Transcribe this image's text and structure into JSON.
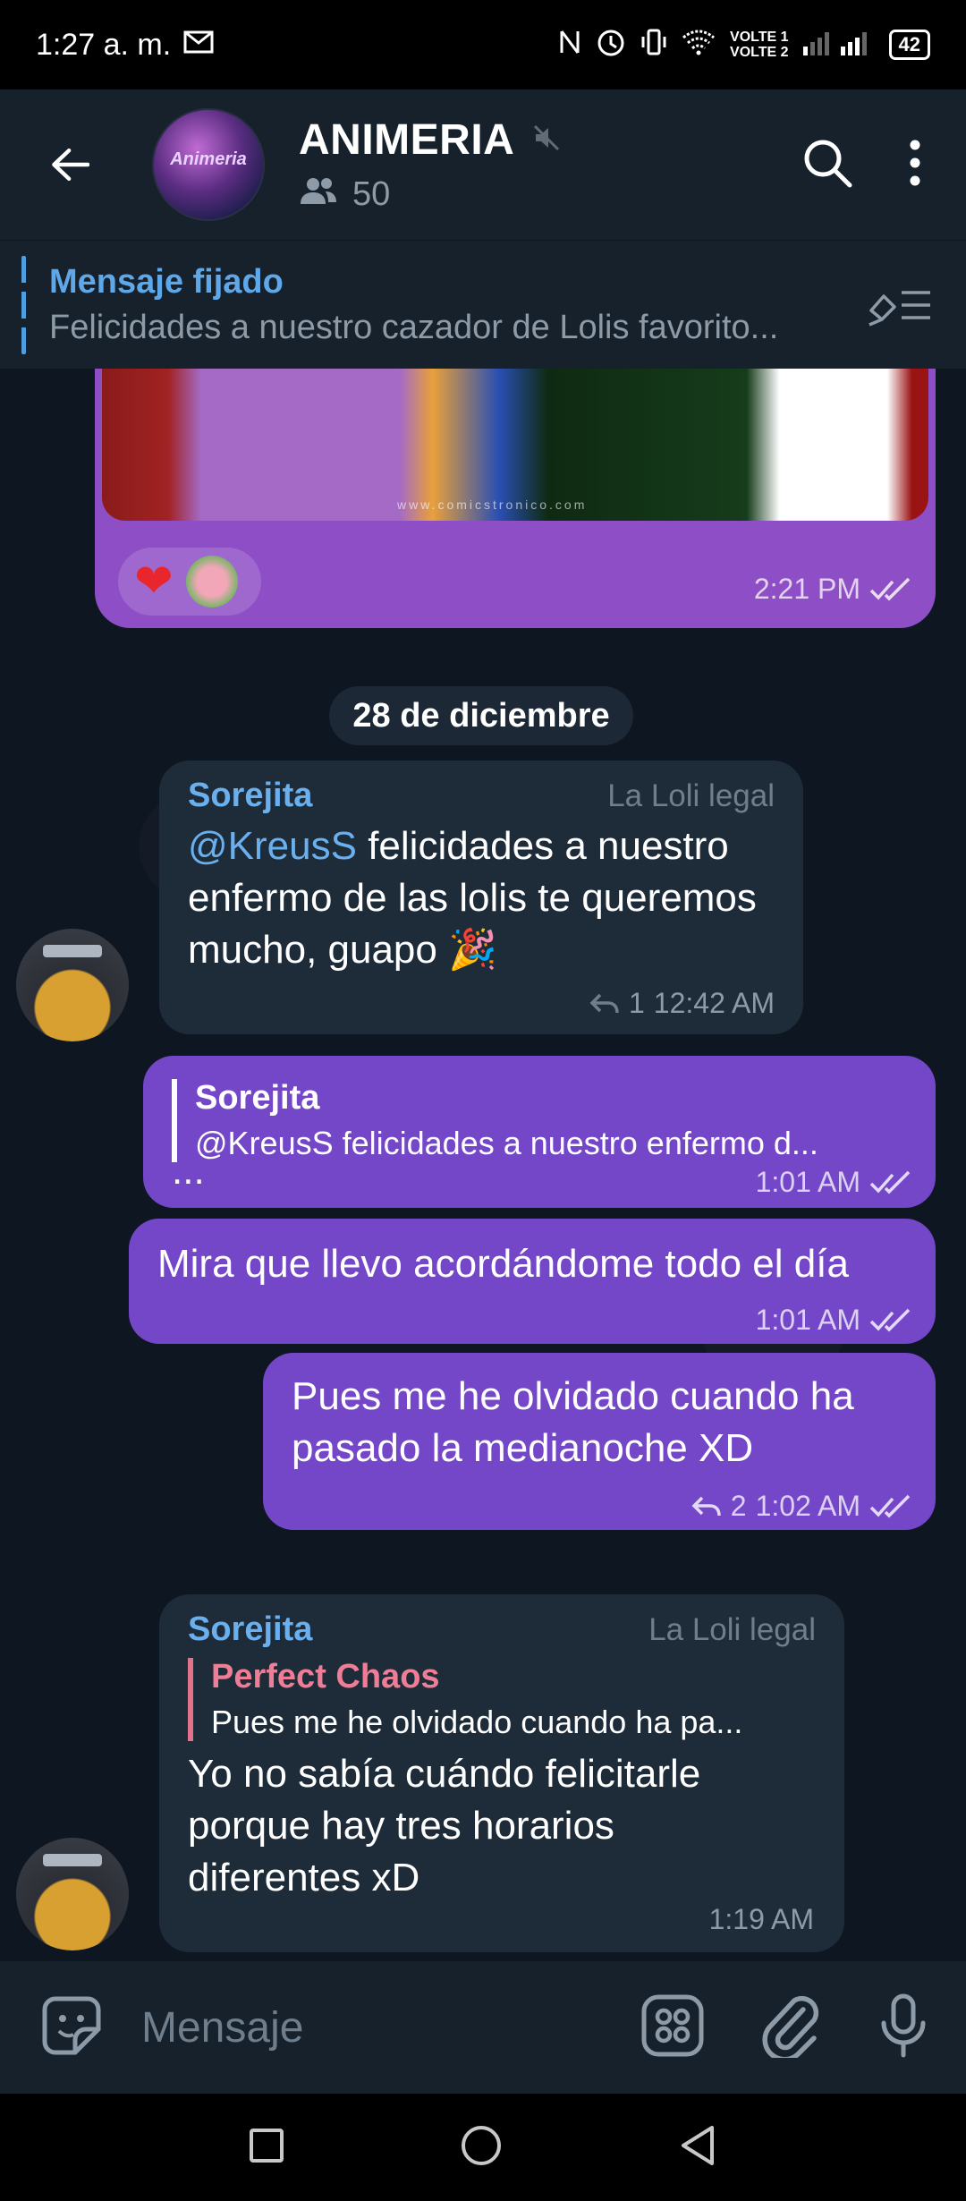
{
  "status_bar": {
    "time": "1:27 a. m.",
    "mail_icon": "M",
    "volte1": "VOLTE 1",
    "volte2": "VOLTE 2",
    "battery": "42"
  },
  "header": {
    "title": "ANIMERIA",
    "avatar_text": "Animeria",
    "members_count": "50",
    "muted": true
  },
  "pinned": {
    "label": "Mensaje fijado",
    "message": "Felicidades a nuestro cazador de Lolis favorito..."
  },
  "messages": {
    "image_msg": {
      "watermark": "www.comicstronico.com",
      "reaction": "❤",
      "time": "2:21 PM"
    },
    "date_divider": "28 de diciembre",
    "msg1": {
      "sender": "Sorejita",
      "role": "La Loli legal",
      "mention": "@KreusS",
      "text": " felicidades a nuestro enfermo de las lolis te queremos mucho, guapo 🎉",
      "replies": "1",
      "time": "12:42 AM"
    },
    "msg2": {
      "reply_name": "Sorejita",
      "reply_text": "@KreusS felicidades a nuestro enfermo d...",
      "text": "...",
      "time": "1:01 AM"
    },
    "msg3": {
      "text": "Mira que llevo acordándome todo el día",
      "time": "1:01 AM"
    },
    "msg4": {
      "text": "Pues me he olvidado cuando ha pasado la medianoche XD",
      "replies": "2",
      "time": "1:02 AM"
    },
    "msg5": {
      "sender": "Sorejita",
      "role": "La Loli legal",
      "reply_name": "Perfect Chaos",
      "reply_text": "Pues me he olvidado cuando ha pa...",
      "text": "Yo no sabía cuándo felicitarle porque hay tres horarios diferentes xD",
      "time": "1:19 AM"
    }
  },
  "input": {
    "placeholder": "Mensaje"
  },
  "colors": {
    "outgoing_bubble": "#7447c9",
    "incoming_bubble": "#1e2c3a",
    "accent_blue": "#6ab0ef",
    "reply_pink": "#f07d96"
  }
}
